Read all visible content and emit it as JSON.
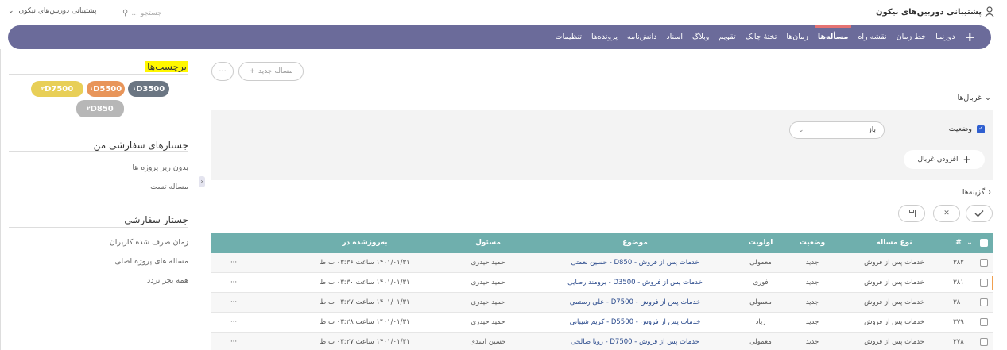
{
  "header": {
    "brand": "پشتیبانی دوربین‌های نیکون",
    "search_placeholder": "جستجو ...",
    "project_select": "پشتیبانی دوربین‌های نیکون"
  },
  "nav": {
    "items": [
      {
        "label": "+"
      },
      {
        "label": "دورنما"
      },
      {
        "label": "خط زمان"
      },
      {
        "label": "نقشه راه"
      },
      {
        "label": "مسأله‌ها"
      },
      {
        "label": "زمان‌ها"
      },
      {
        "label": "تختهٔ چابک"
      },
      {
        "label": "تقویم"
      },
      {
        "label": "وبلاگ"
      },
      {
        "label": "اسناد"
      },
      {
        "label": "دانش‌نامه"
      },
      {
        "label": "پرونده‌ها"
      },
      {
        "label": "تنظیمات"
      }
    ],
    "active": "مسأله‌ها"
  },
  "sidebar": {
    "tags_title": "برچسب‌ها",
    "tags": [
      {
        "label": "D7500",
        "sup": "۲",
        "color": "#e8cf57"
      },
      {
        "label": "D5500",
        "sup": "۱",
        "color": "#e8955a"
      },
      {
        "label": "D3500",
        "sup": "۱",
        "color": "#6b7683"
      },
      {
        "label": "D850",
        "sup": "۲",
        "color": "#b7b7b7"
      }
    ],
    "my_queries_title": "جستارهای سفارشی من",
    "my_queries": [
      "بدون زیر پروژه ها",
      "مساله تست"
    ],
    "custom_title": "جستار سفارشی",
    "custom_queries": [
      "زمان صرف شده کاربران",
      "مساله های پروژه اصلی",
      "همه بجز تردد"
    ]
  },
  "main": {
    "new_issue": "مساله جدید",
    "more": "···",
    "filters_label": "غربال‌ها",
    "status_label": "وضعیت",
    "status_value": "باز",
    "add_filter": "افزودن غربال",
    "options_label": "گزینه‌ها"
  },
  "table": {
    "headers": [
      "#",
      "نوع مساله",
      "وضعیت",
      "اولویت",
      "موضوع",
      "مسئول",
      "به‌روزشده در"
    ],
    "rows": [
      {
        "id": "۳۸۲",
        "type": "خدمات پس از فروش",
        "status": "جدید",
        "priority": "معمولی",
        "subject": "خدمات پس از فروش - D850 - حسین نعمتی",
        "assignee": "حمید حیدری",
        "updated": "۱۴۰۱/۰۱/۳۱ ساعت ۰۳:۳۶ ب.ظ",
        "more": "···"
      },
      {
        "id": "۳۸۱",
        "type": "خدمات پس از فروش",
        "status": "جدید",
        "priority": "فوری",
        "subject": "خدمات پس از فروش - D3500 - برومند رضایی",
        "assignee": "حمید حیدری",
        "updated": "۱۴۰۱/۰۱/۳۱ ساعت ۰۳:۳۰ ب.ظ",
        "more": "···"
      },
      {
        "id": "۳۸۰",
        "type": "خدمات پس از فروش",
        "status": "جدید",
        "priority": "معمولی",
        "subject": "خدمات پس از فروش - D7500 - علی رستمی",
        "assignee": "حمید حیدری",
        "updated": "۱۴۰۱/۰۱/۳۱ ساعت ۰۳:۲۷ ب.ظ",
        "more": "···"
      },
      {
        "id": "۳۷۹",
        "type": "خدمات پس از فروش",
        "status": "جدید",
        "priority": "زیاد",
        "subject": "خدمات پس از فروش - D5500 - کریم شیبانی",
        "assignee": "حمید حیدری",
        "updated": "۱۴۰۱/۰۱/۳۱ ساعت ۰۳:۲۸ ب.ظ",
        "more": "···"
      },
      {
        "id": "۳۷۸",
        "type": "خدمات پس از فروش",
        "status": "جدید",
        "priority": "معمولی",
        "subject": "خدمات پس از فروش - D7500 - رویا صالحی",
        "assignee": "حسین اسدی",
        "updated": "۱۴۰۱/۰۱/۳۱ ساعت ۰۳:۲۷ ب.ظ",
        "more": "···"
      }
    ]
  }
}
